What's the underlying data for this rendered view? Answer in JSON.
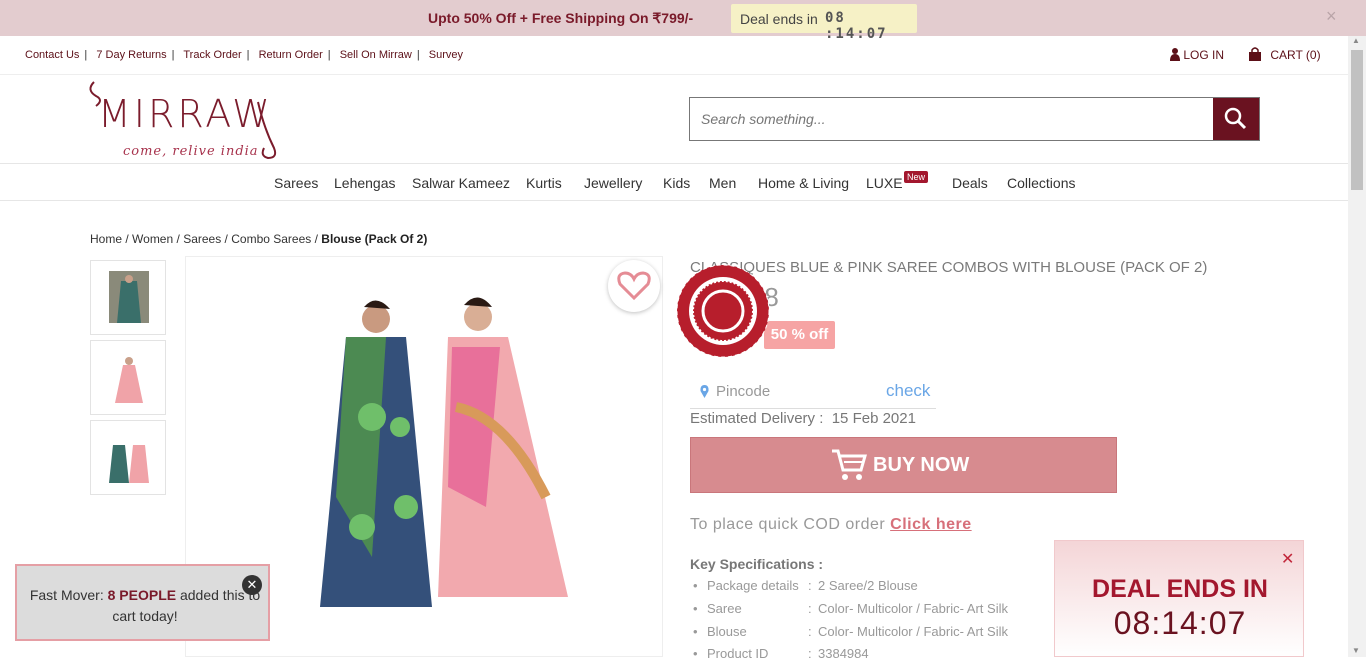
{
  "promo": {
    "text": "Upto 50% Off + Free Shipping On ₹799/-",
    "deal_label": "Deal ends in",
    "deal_time": "08 :14:07",
    "close": "×"
  },
  "util_links": [
    "Contact Us",
    "7 Day Returns",
    "Track Order",
    "Return Order",
    "Sell On Mirraw",
    "Survey"
  ],
  "account": {
    "login": "LOG IN",
    "cart": "CART (0)"
  },
  "logo": {
    "word": "MIRRAW",
    "tagline": "come, relive india"
  },
  "search": {
    "placeholder": "Search something..."
  },
  "nav": [
    "Sarees",
    "Lehengas",
    "Salwar Kameez",
    "Kurtis",
    "Jewellery",
    "Kids",
    "Men",
    "Home & Living",
    "LUXE",
    "Deals",
    "Collections"
  ],
  "nav_badge": "New",
  "breadcrumb": {
    "items": [
      "Home",
      "Women",
      "Sarees",
      "Combo Sarees"
    ],
    "current": "Blouse (Pack Of 2)"
  },
  "product": {
    "title": "CLASSIQUES BLUE & PINK SAREE COMBOS WITH BLOUSE (PACK OF 2)",
    "price": "₹ 1,098",
    "discount": "50 % off"
  },
  "pincode": {
    "placeholder": "Pincode",
    "check": "check"
  },
  "delivery": {
    "label": "Estimated Delivery :",
    "date": "15 Feb 2021"
  },
  "buy_now": "BUY NOW",
  "cod": {
    "text": "To place quick COD order",
    "link": "Click here"
  },
  "specs": {
    "heading": "Key Specifications :",
    "rows": [
      {
        "k": "Package details",
        "v": "2 Saree/2 Blouse"
      },
      {
        "k": "Saree",
        "v": "Color- Multicolor / Fabric- Art Silk"
      },
      {
        "k": "Blouse",
        "v": "Color- Multicolor / Fabric- Art Silk"
      },
      {
        "k": "Product ID",
        "v": "3384984"
      }
    ]
  },
  "fast_mover": {
    "prefix": "Fast Mover:",
    "count": "8 PEOPLE",
    "suffix": "added this to cart today!",
    "close": "✕"
  },
  "deal_popup": {
    "title": "DEAL ENDS IN",
    "time": "08:14:07",
    "close": "✕"
  },
  "colors": {
    "brand": "#6a1220",
    "accent": "#a3172e",
    "promo_bg": "#e3cccf"
  }
}
